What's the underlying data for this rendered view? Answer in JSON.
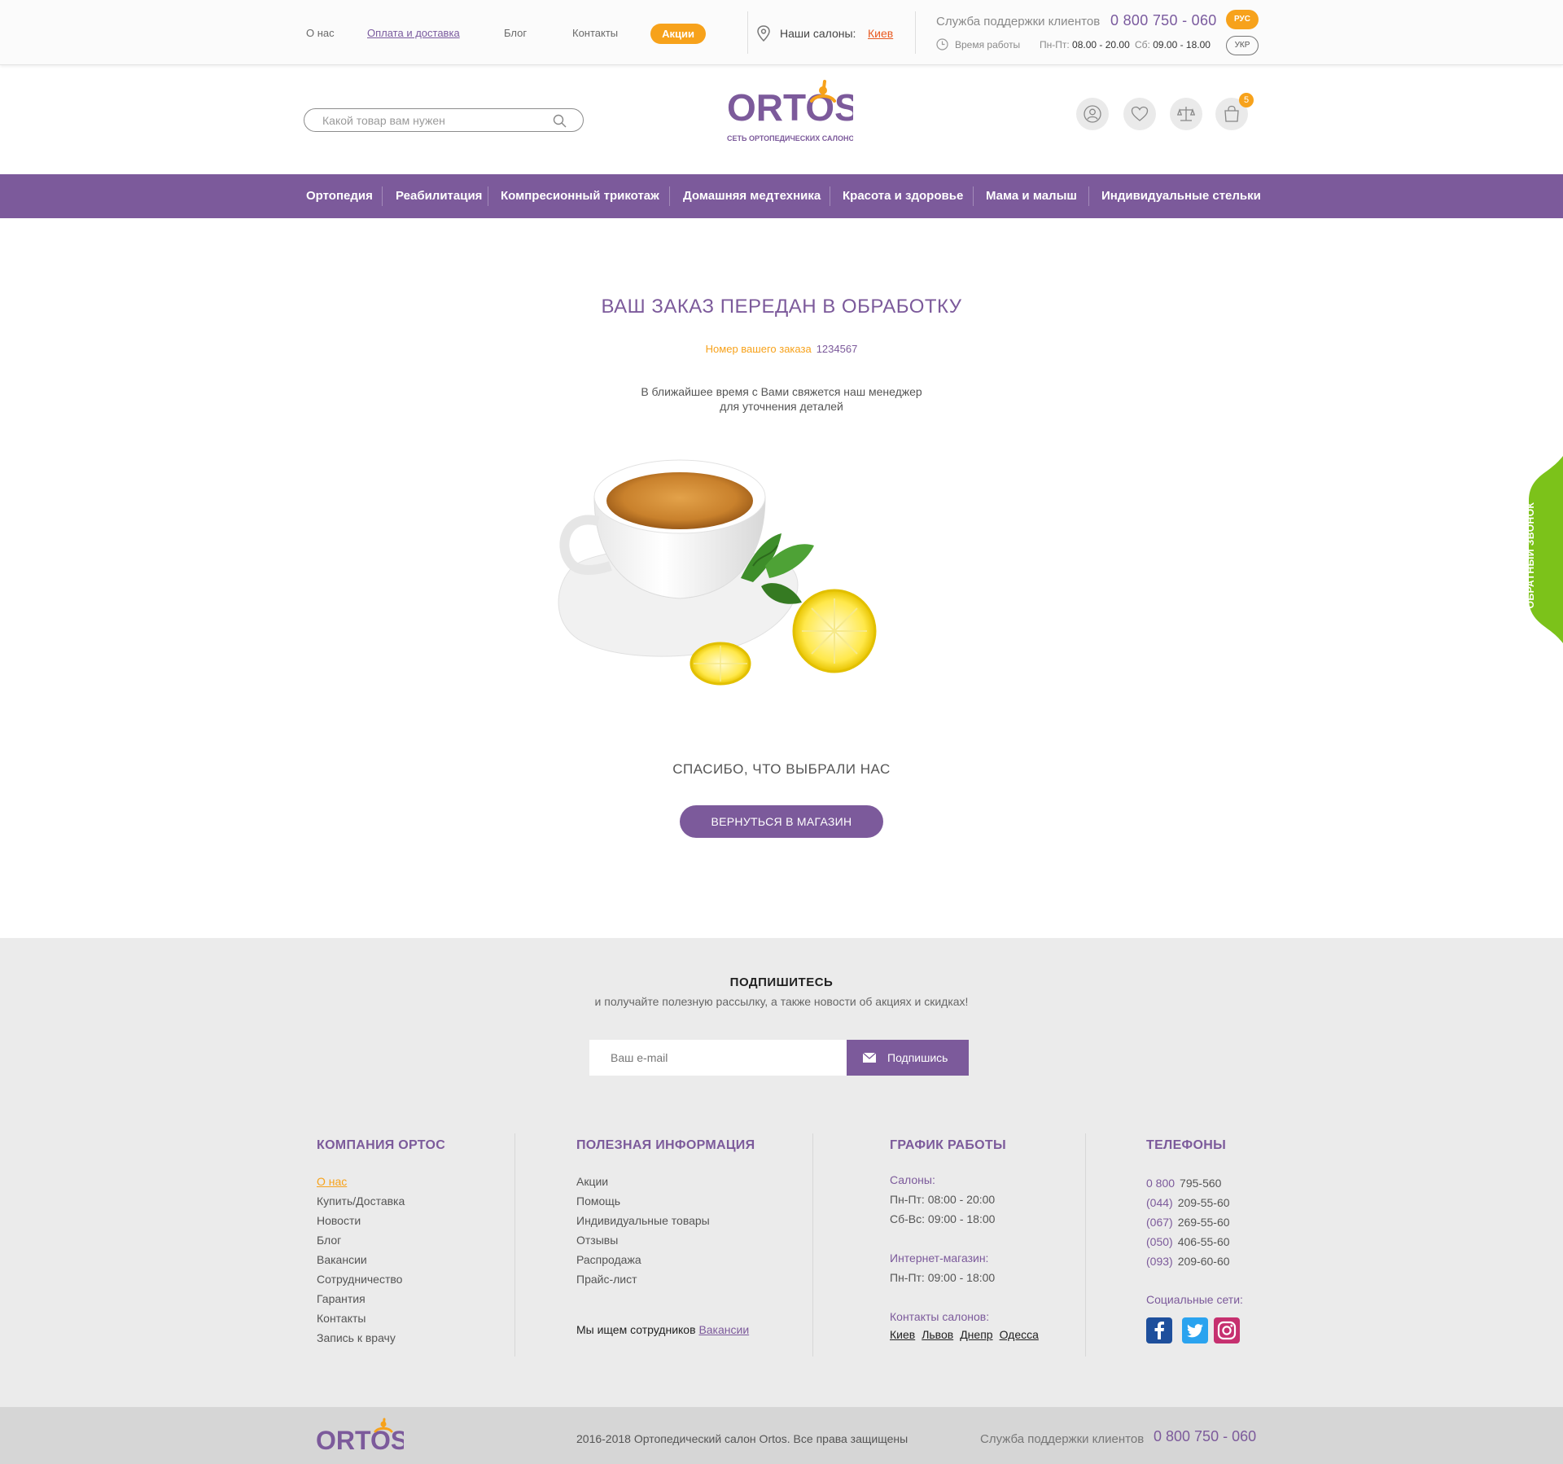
{
  "colors": {
    "brand_purple": "#7c5a9b",
    "accent_orange": "#f7a21b",
    "callback_green": "#7cc21a"
  },
  "topbar": {
    "links": [
      "О нас",
      "Оплата и доставка",
      "Блог",
      "Контакты"
    ],
    "promo": "Акции",
    "salons_label": "Наши салоны:",
    "salons_city": "Киев",
    "support_label": "Служба поддержки клиентов",
    "support_phone": "0 800 750 - 060",
    "hours_label": "Время работы",
    "hours_weekdays_prefix": "Пн-Пт:",
    "hours_weekdays": "08.00 - 20.00",
    "hours_weekend_prefix": "Сб:",
    "hours_weekend": "09.00 - 18.00",
    "lang_active": "РУС",
    "lang_other": "УКР"
  },
  "header": {
    "search_placeholder": "Какой товар вам нужен",
    "logo_text": "ORTOS",
    "logo_subtitle": "СЕТЬ ОРТОПЕДИЧЕСКИХ САЛОНОВ",
    "icons": [
      "user-icon",
      "heart-icon",
      "compare-icon",
      "cart-icon"
    ],
    "cart_count": "5"
  },
  "nav": [
    "Ортопедия",
    "Реабилитация",
    "Компресионный трикотаж",
    "Домашняя медтехника",
    "Красота и здоровье",
    "Мама и малыш",
    "Индивидуальные стельки"
  ],
  "main": {
    "title": "ВАШ ЗАКАЗ ПЕРЕДАН В ОБРАБОТКУ",
    "order_label": "Номер вашего заказа",
    "order_number": "1234567",
    "message_line1": "В ближайшее время с Вами свяжется наш менеджер",
    "message_line2": "для уточнения деталей",
    "thanks": "СПАСИБО, ЧТО  ВЫБРАЛИ НАС",
    "return_button": "ВЕРНУТЬСЯ В МАГАЗИН"
  },
  "callback": "ОБРАТНЫЙ ЗВОНОК",
  "subscribe": {
    "title": "ПОДПИШИТЕСЬ",
    "text": "и получайте полезную рассылку, а также новости об акциях и скидках!",
    "placeholder": "Ваш e-mail",
    "button": "Подпишись"
  },
  "footer": {
    "company": {
      "title": "КОМПАНИЯ ОРТОС",
      "items": [
        "О нас",
        "Купить/Доставка",
        "Новости",
        "Блог",
        "Вакансии",
        "Сотрудничество",
        "Гарантия",
        "Контакты",
        "Запись к врачу"
      ]
    },
    "info": {
      "title": "ПОЛЕЗНАЯ ИНФОРМАЦИЯ",
      "items": [
        "Акции",
        "Помощь",
        "Индивидуальные товары",
        "Отзывы",
        "Распродажа",
        "Прайс-лист"
      ],
      "jobs_text": "Мы ищем сотрудников",
      "jobs_link": "Вакансии"
    },
    "schedule": {
      "title": "ГРАФИК РАБОТЫ",
      "salons_head": "Салоны:",
      "salons_wd": "Пн-Пт: 08:00 - 20:00",
      "salons_we": "Сб-Вс: 09:00 - 18:00",
      "shop_head": "Интернет-магазин:",
      "shop_hours": "Пн-Пт: 09:00 - 18:00",
      "contacts_head": "Контакты салонов:",
      "cities": [
        "Киев",
        "Львов",
        "Днепр",
        "Одесса"
      ]
    },
    "phones": {
      "title": "ТЕЛЕФОНЫ",
      "items": [
        {
          "code": "0 800",
          "number": "795-560"
        },
        {
          "code": "(044)",
          "number": "209-55-60"
        },
        {
          "code": "(067)",
          "number": "269-55-60"
        },
        {
          "code": "(050)",
          "number": "406-55-60"
        },
        {
          "code": "(093)",
          "number": "209-60-60"
        }
      ],
      "social_title": "Социальные сети:",
      "social": [
        "facebook-icon",
        "twitter-icon",
        "instagram-icon"
      ]
    }
  },
  "bottom": {
    "copyright": "2016-2018  Ортопедический салон Ortos. Все права защищены",
    "support_label": "Служба поддержки клиентов",
    "support_phone": "0 800 750 - 060"
  }
}
